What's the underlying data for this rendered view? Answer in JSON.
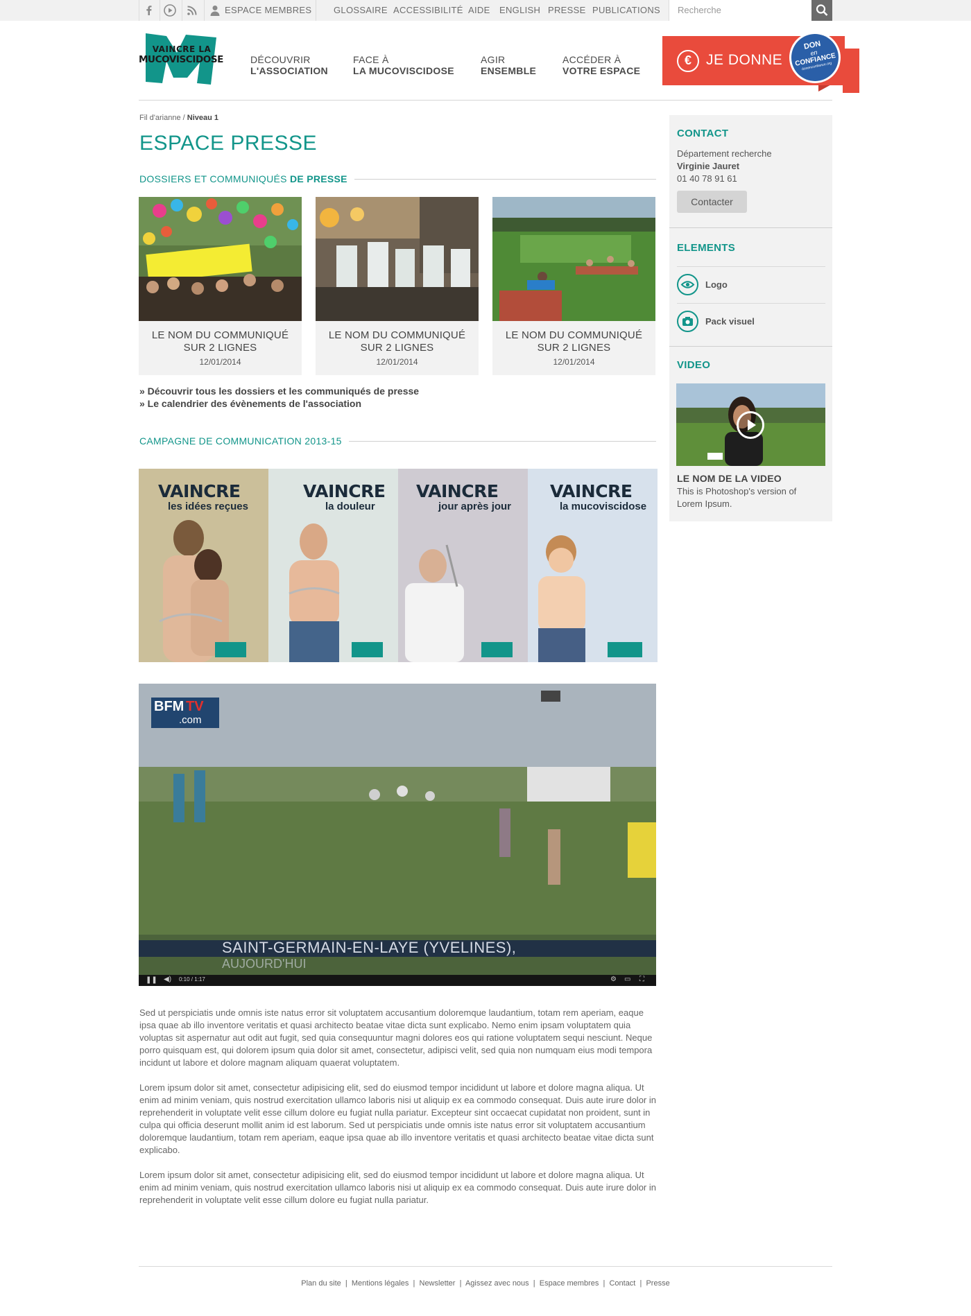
{
  "topbar": {
    "members_label": "ESPACE MEMBRES",
    "links": [
      "GLOSSAIRE",
      "ACCESSIBILITÉ",
      "AIDE",
      "ENGLISH",
      "PRESSE",
      "PUBLICATIONS"
    ],
    "search_placeholder": "Recherche"
  },
  "logo": {
    "line1": "VAINCRE LA",
    "line2": "MUCOVISCIDOSE"
  },
  "nav": [
    {
      "line1": "DÉCOUVRIR",
      "line2": "L'ASSOCIATION"
    },
    {
      "line1": "FACE À",
      "line2": "LA MUCOVISCIDOSE"
    },
    {
      "line1": "AGIR",
      "line2": "ENSEMBLE"
    },
    {
      "line1": "ACCÉDER À",
      "line2": "VOTRE ESPACE"
    }
  ],
  "donate": {
    "label": "JE DONNE",
    "badge_line1": "DON",
    "badge_line2": "en",
    "badge_line3": "CONFIANCE",
    "badge_small": "donenconfiance.org"
  },
  "breadcrumb": {
    "root": "Fil d'arianne",
    "sep": " / ",
    "current": "Niveau 1"
  },
  "page_title": "ESPACE PRESSE",
  "section_press": {
    "title_a": "DOSSIERS ET COMMUNIQUÉS ",
    "title_b": "DE PRESSE"
  },
  "cards": [
    {
      "line1": "LE NOM DU COMMUNIQUÉ",
      "line2": "SUR 2 LIGNES",
      "date": "12/01/2014"
    },
    {
      "line1": "LE NOM DU COMMUNIQUÉ",
      "line2": "SUR 2 LIGNES",
      "date": "12/01/2014"
    },
    {
      "line1": "LE NOM DU COMMUNIQUÉ",
      "line2": "SUR 2 LIGNES",
      "date": "12/01/2014"
    }
  ],
  "more_links": [
    "» Découvrir tous les dossiers et les communiqués de presse",
    "» Le calendrier des évènements de l'association"
  ],
  "section_campaign": "CAMPAGNE DE COMMUNICATION 2013-15",
  "posters": [
    {
      "big": "VAINCRE",
      "small": "les idées reçues"
    },
    {
      "big": "VAINCRE",
      "small": "la douleur"
    },
    {
      "big": "VAINCRE",
      "small": "jour après jour"
    },
    {
      "big": "VAINCRE",
      "small": "la mucoviscidose"
    }
  ],
  "video": {
    "brand1": "BFM",
    "brand2": "TV",
    "brand3": ".com",
    "caption_line1": "SAINT-GERMAIN-EN-LAYE (YVELINES),",
    "caption_line2": "AUJOURD'HUI",
    "time": "0:10 / 1:17"
  },
  "paragraphs": [
    "Sed ut perspiciatis unde omnis iste natus error sit voluptatem accusantium doloremque laudantium, totam rem aperiam, eaque ipsa quae ab illo inventore veritatis et quasi architecto beatae vitae dicta sunt explicabo. Nemo enim ipsam voluptatem quia voluptas sit aspernatur aut odit aut fugit, sed quia consequuntur magni dolores eos qui ratione voluptatem sequi nesciunt. Neque porro quisquam est, qui dolorem ipsum quia dolor sit amet, consectetur, adipisci velit, sed quia non numquam eius modi tempora incidunt ut labore et dolore magnam aliquam quaerat voluptatem.",
    "Lorem ipsum dolor sit amet, consectetur adipisicing elit, sed do eiusmod tempor incididunt ut labore et dolore magna aliqua. Ut enim ad minim veniam, quis nostrud exercitation ullamco laboris nisi ut aliquip ex ea commodo consequat. Duis aute irure dolor in reprehenderit in voluptate velit esse cillum dolore eu fugiat nulla pariatur. Excepteur sint occaecat cupidatat non proident, sunt in culpa qui officia deserunt mollit anim id est laborum. Sed ut perspiciatis unde omnis iste natus error sit voluptatem accusantium doloremque laudantium, totam rem aperiam, eaque ipsa quae ab illo inventore veritatis et quasi architecto beatae vitae dicta sunt explicabo.",
    "Lorem ipsum dolor sit amet, consectetur adipisicing elit, sed do eiusmod tempor incididunt ut labore et dolore magna aliqua. Ut enim ad minim veniam, quis nostrud exercitation ullamco laboris nisi ut aliquip ex ea commodo consequat. Duis aute irure dolor in reprehenderit in voluptate velit esse cillum dolore eu fugiat nulla pariatur."
  ],
  "sidebar": {
    "contact_title": "CONTACT",
    "department": "Département recherche",
    "name": "Virginie Jauret",
    "phone": "01 40 78 91 61",
    "contact_button": "Contacter",
    "elements_title": "ELEMENTS",
    "element_logo": "Logo",
    "element_pack": "Pack visuel",
    "video_title": "VIDEO",
    "video_name": "LE NOM DE LA VIDEO",
    "video_desc": "This is Photoshop's version of Lorem Ipsum."
  },
  "footer": [
    "Plan du site",
    "Mentions légales",
    "Newsletter",
    "Agissez avec nous",
    "Espace membres",
    "Contact",
    "Presse"
  ],
  "colors": {
    "accent": "#12958a",
    "donate": "#e94b3c",
    "badge": "#2a5fa8"
  }
}
